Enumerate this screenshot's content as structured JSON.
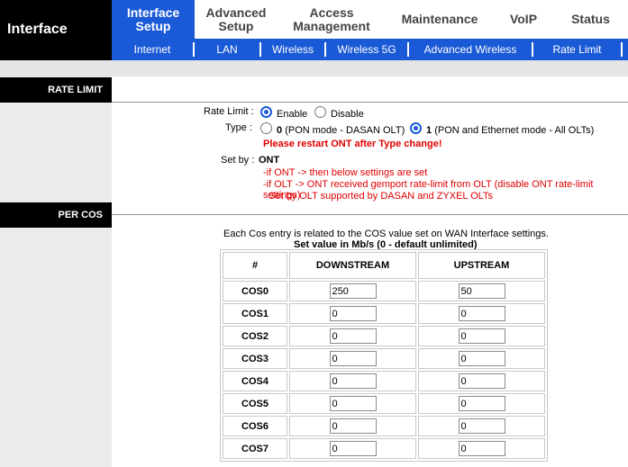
{
  "brand": "Interface",
  "top_nav": [
    {
      "line1": "Interface",
      "line2": "Setup"
    },
    {
      "line1": "Advanced",
      "line2": "Setup"
    },
    {
      "line1": "Access",
      "line2": "Management"
    },
    {
      "line1": "Maintenance",
      "line2": ""
    },
    {
      "line1": "VoIP",
      "line2": ""
    },
    {
      "line1": "Status",
      "line2": ""
    }
  ],
  "sub_nav": [
    "Internet",
    "LAN",
    "Wireless",
    "Wireless 5G",
    "Advanced Wireless",
    "Rate Limit"
  ],
  "sections": {
    "rate_limit": "RATE LIMIT",
    "per_cos": "PER COS"
  },
  "rate_limit": {
    "label": "Rate Limit :",
    "enable": "Enable",
    "disable": "Disable",
    "selected": "Enable"
  },
  "type": {
    "label": "Type :",
    "opt0_num": "0",
    "opt0_text": "(PON mode - DASAN OLT)",
    "opt1_num": "1",
    "opt1_text": "(PON and Ethernet mode - All OLTs)",
    "selected": "1",
    "warning": "Please restart ONT after Type change!"
  },
  "set_by": {
    "label": "Set by :",
    "value": "ONT",
    "note1": "-if ONT -> then below settings are set",
    "note2": "-if OLT -> ONT received gemport rate-limit from OLT (disable ONT rate-limit settings)",
    "note3": "Set by OLT supported by DASAN and ZYXEL OLTs"
  },
  "cos_info": {
    "line1": "Each Cos entry is related to the COS value set on WAN Interface settings.",
    "line2": "Set value in Mb/s (0 - default unlimited)"
  },
  "cos_table": {
    "headers": [
      "#",
      "DOWNSTREAM",
      "UPSTREAM"
    ],
    "rows": [
      {
        "name": "COS0",
        "down": "250",
        "up": "50"
      },
      {
        "name": "COS1",
        "down": "0",
        "up": "0"
      },
      {
        "name": "COS2",
        "down": "0",
        "up": "0"
      },
      {
        "name": "COS3",
        "down": "0",
        "up": "0"
      },
      {
        "name": "COS4",
        "down": "0",
        "up": "0"
      },
      {
        "name": "COS5",
        "down": "0",
        "up": "0"
      },
      {
        "name": "COS6",
        "down": "0",
        "up": "0"
      },
      {
        "name": "COS7",
        "down": "0",
        "up": "0"
      }
    ]
  },
  "colors": {
    "accent": "#1a5ad6",
    "warning": "#e00000",
    "header_bg": "#000000"
  }
}
